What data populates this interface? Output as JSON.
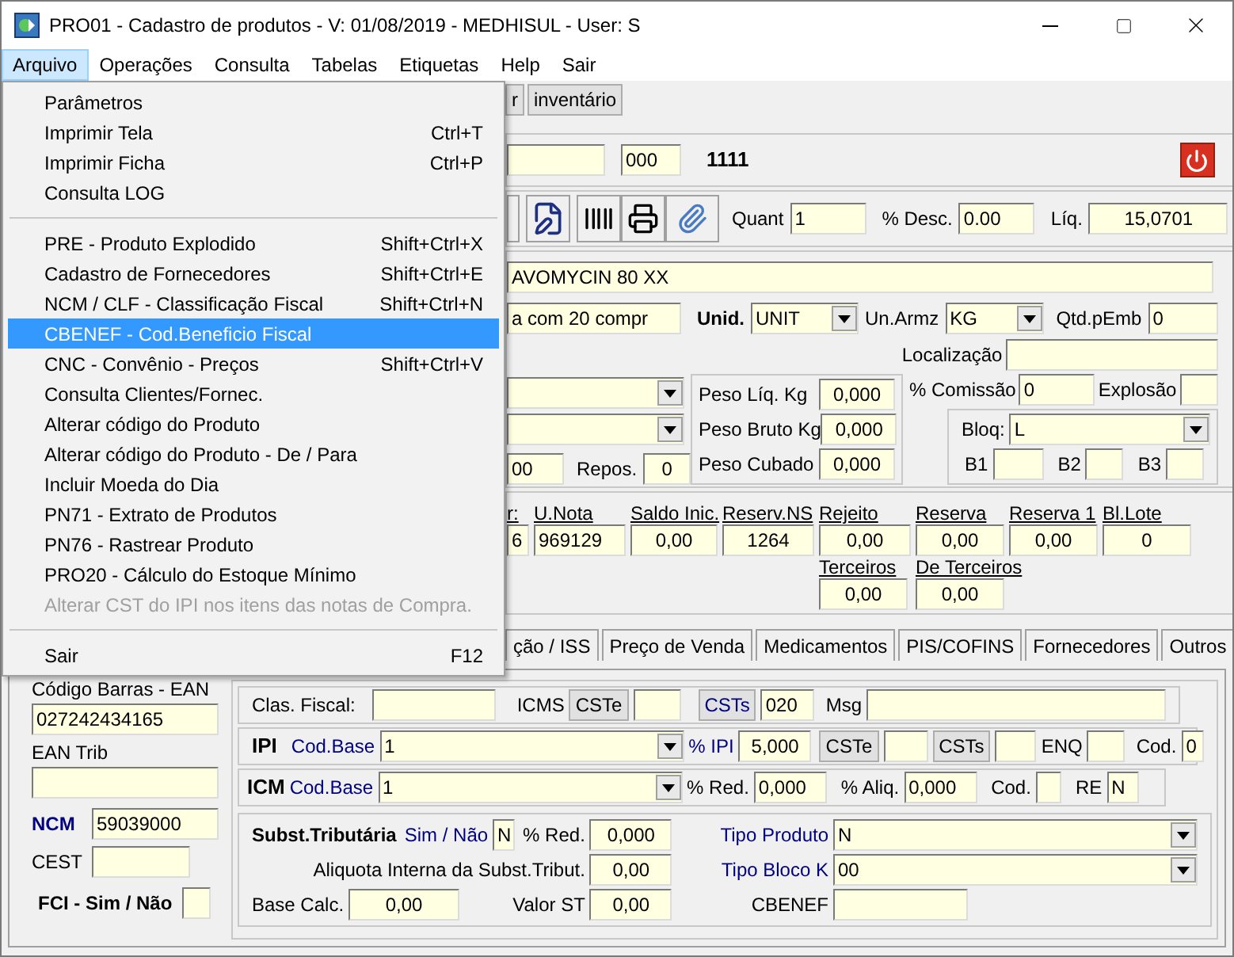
{
  "window": {
    "title": "PRO01 - Cadastro de produtos - V: 01/08/2019 - MEDHISUL - User: S"
  },
  "menu_bar": [
    {
      "label": "Arquivo",
      "selected": true
    },
    {
      "label": "Operações",
      "selected": false
    },
    {
      "label": "Consulta",
      "selected": false
    },
    {
      "label": "Tabelas",
      "selected": false
    },
    {
      "label": "Etiquetas",
      "selected": false
    },
    {
      "label": "Help",
      "selected": false
    },
    {
      "label": "Sair",
      "selected": false
    }
  ],
  "arquivo_menu": [
    {
      "kind": "item",
      "label": "Parâmetros",
      "selected": false,
      "disabled": false
    },
    {
      "kind": "item",
      "label": "Imprimir Tela",
      "shortcut": "Ctrl+T",
      "selected": false,
      "disabled": false
    },
    {
      "kind": "item",
      "label": "Imprimir Ficha",
      "shortcut": "Ctrl+P",
      "selected": false,
      "disabled": false
    },
    {
      "kind": "item",
      "label": "Consulta LOG",
      "selected": false,
      "disabled": false
    },
    {
      "kind": "separator"
    },
    {
      "kind": "item",
      "label": "PRE - Produto Explodido",
      "shortcut": "Shift+Ctrl+X",
      "selected": false,
      "disabled": false
    },
    {
      "kind": "item",
      "label": "Cadastro de Fornecedores",
      "shortcut": "Shift+Ctrl+E",
      "selected": false,
      "disabled": false
    },
    {
      "kind": "item",
      "label": "NCM / CLF - Classificação Fiscal",
      "shortcut": "Shift+Ctrl+N",
      "selected": false,
      "disabled": false
    },
    {
      "kind": "item",
      "label": "CBENEF - Cod.Beneficio Fiscal",
      "selected": true,
      "disabled": false
    },
    {
      "kind": "item",
      "label": "CNC - Convênio - Preços",
      "shortcut": "Shift+Ctrl+V",
      "selected": false,
      "disabled": false
    },
    {
      "kind": "item",
      "label": "Consulta Clientes/Fornec.",
      "selected": false,
      "disabled": false
    },
    {
      "kind": "item",
      "label": "Alterar código do Produto",
      "selected": false,
      "disabled": false
    },
    {
      "kind": "item",
      "label": "Alterar código do Produto - De / Para",
      "selected": false,
      "disabled": false
    },
    {
      "kind": "item",
      "label": "Incluir Moeda do Dia",
      "selected": false,
      "disabled": false
    },
    {
      "kind": "item",
      "label": "PN71 - Extrato de Produtos",
      "selected": false,
      "disabled": false
    },
    {
      "kind": "item",
      "label": "PN76 - Rastrear Produto",
      "selected": false,
      "disabled": false
    },
    {
      "kind": "item",
      "label": "PRO20 - Cálculo do Estoque Mínimo",
      "selected": false,
      "disabled": false
    },
    {
      "kind": "item",
      "label": "Alterar CST do IPI nos itens das notas de Compra.",
      "selected": false,
      "disabled": true
    },
    {
      "kind": "separator"
    },
    {
      "kind": "item",
      "label": "Sair",
      "shortcut": "F12",
      "selected": false,
      "disabled": false
    }
  ],
  "toolbar": {
    "buttons": [
      "r",
      "inventário"
    ]
  },
  "header": {
    "code_suffix": "000",
    "number": "1111"
  },
  "pricing": {
    "quant_label": "Quant",
    "quant": "1",
    "desc_label": "% Desc.",
    "desc": "0.00",
    "liq_label": "Líq.",
    "liq": "15,0701"
  },
  "product": {
    "description": "AVOMYCIN 80 XX",
    "presentation": "a com 20 compr",
    "unid_label": "Unid.",
    "unid": "UNIT",
    "un_armz_label": "Un.Armz",
    "un_armz": "KG",
    "qtd_emb_label": "Qtd.pEmb",
    "qtd_emb": "0",
    "localizacao_label": "Localização",
    "field_00": "00",
    "repos_label": "Repos.",
    "repos": "0",
    "comissao_label": "% Comissão",
    "comissao": "0",
    "explosao_label": "Explosão",
    "bloq_label": "Bloq:",
    "bloq": "L",
    "b_labels": [
      "B1",
      "B2",
      "B3"
    ]
  },
  "weights": [
    {
      "label": "Peso Líq. Kg",
      "value": "0,000"
    },
    {
      "label": "Peso Bruto Kg",
      "value": "0,000"
    },
    {
      "label": "Peso Cubado",
      "value": "0,000"
    }
  ],
  "stock": {
    "columns": [
      {
        "label": "r:",
        "value": "6"
      },
      {
        "label": "U.Nota",
        "value": "969129"
      },
      {
        "label": "Saldo Inic.",
        "value": "0,00"
      },
      {
        "label": "Reserv.NS",
        "value": "1264"
      },
      {
        "label": "Rejeito",
        "value": "0,00"
      },
      {
        "label": "Reserva",
        "value": "0,00"
      },
      {
        "label": "Reserva 1",
        "value": "0,00"
      },
      {
        "label": "Bl.Lote",
        "value": "0"
      }
    ],
    "extra": [
      {
        "label": "Terceiros",
        "value": "0,00"
      },
      {
        "label": "De Terceiros",
        "value": "0,00"
      }
    ]
  },
  "tabs": [
    {
      "label": "ção / ISS",
      "selected": false
    },
    {
      "label": "Preço de Venda",
      "selected": false
    },
    {
      "label": "Medicamentos",
      "selected": false
    },
    {
      "label": "PIS/COFINS",
      "selected": false
    },
    {
      "label": "Fornecedores",
      "selected": false
    },
    {
      "label": "Outros",
      "selected": false
    }
  ],
  "codes": {
    "ean_label": "Código Barras - EAN",
    "ean": "027242434165",
    "ean_trib_label": "EAN Trib",
    "ncm_label": "NCM",
    "ncm": "59039000",
    "cest_label": "CEST",
    "fci_label": "FCI - Sim / Não"
  },
  "fiscal": {
    "clas_label": "Clas. Fiscal:",
    "icms_label": "ICMS",
    "cste_button": "CSTe",
    "csts_button": "CSTs",
    "csts": "020",
    "msg_label": "Msg",
    "ipi": {
      "label": "IPI",
      "base_label": "Cod.Base",
      "base": "1",
      "pct_label": "% IPI",
      "pct": "5,000",
      "cste_button": "CSTe",
      "csts_button": "CSTs",
      "enq_label": "ENQ",
      "cod_label": "Cod.",
      "cod": "0"
    },
    "icm": {
      "label": "ICM",
      "base_label": "Cod.Base",
      "base": "1",
      "red_label": "% Red.",
      "red": "0,000",
      "aliq_label": "% Aliq.",
      "aliq": "0,000",
      "cod_label": "Cod.",
      "re_label": "RE",
      "re": "N"
    },
    "st": {
      "label": "Subst.Tributária",
      "sim_label": "Sim / Não",
      "sim": "N",
      "red_label": "% Red.",
      "red": "0,000",
      "aliq_label": "Aliquota Interna da Subst.Tribut.",
      "aliq": "0,00",
      "base_label": "Base Calc.",
      "base": "0,00",
      "valor_label": "Valor ST",
      "valor": "0,00",
      "tipo_produto_label": "Tipo Produto",
      "tipo_produto": "N",
      "tipo_bloco_label": "Tipo Bloco K",
      "tipo_bloco": "00",
      "cbenef_label": "CBENEF"
    }
  }
}
